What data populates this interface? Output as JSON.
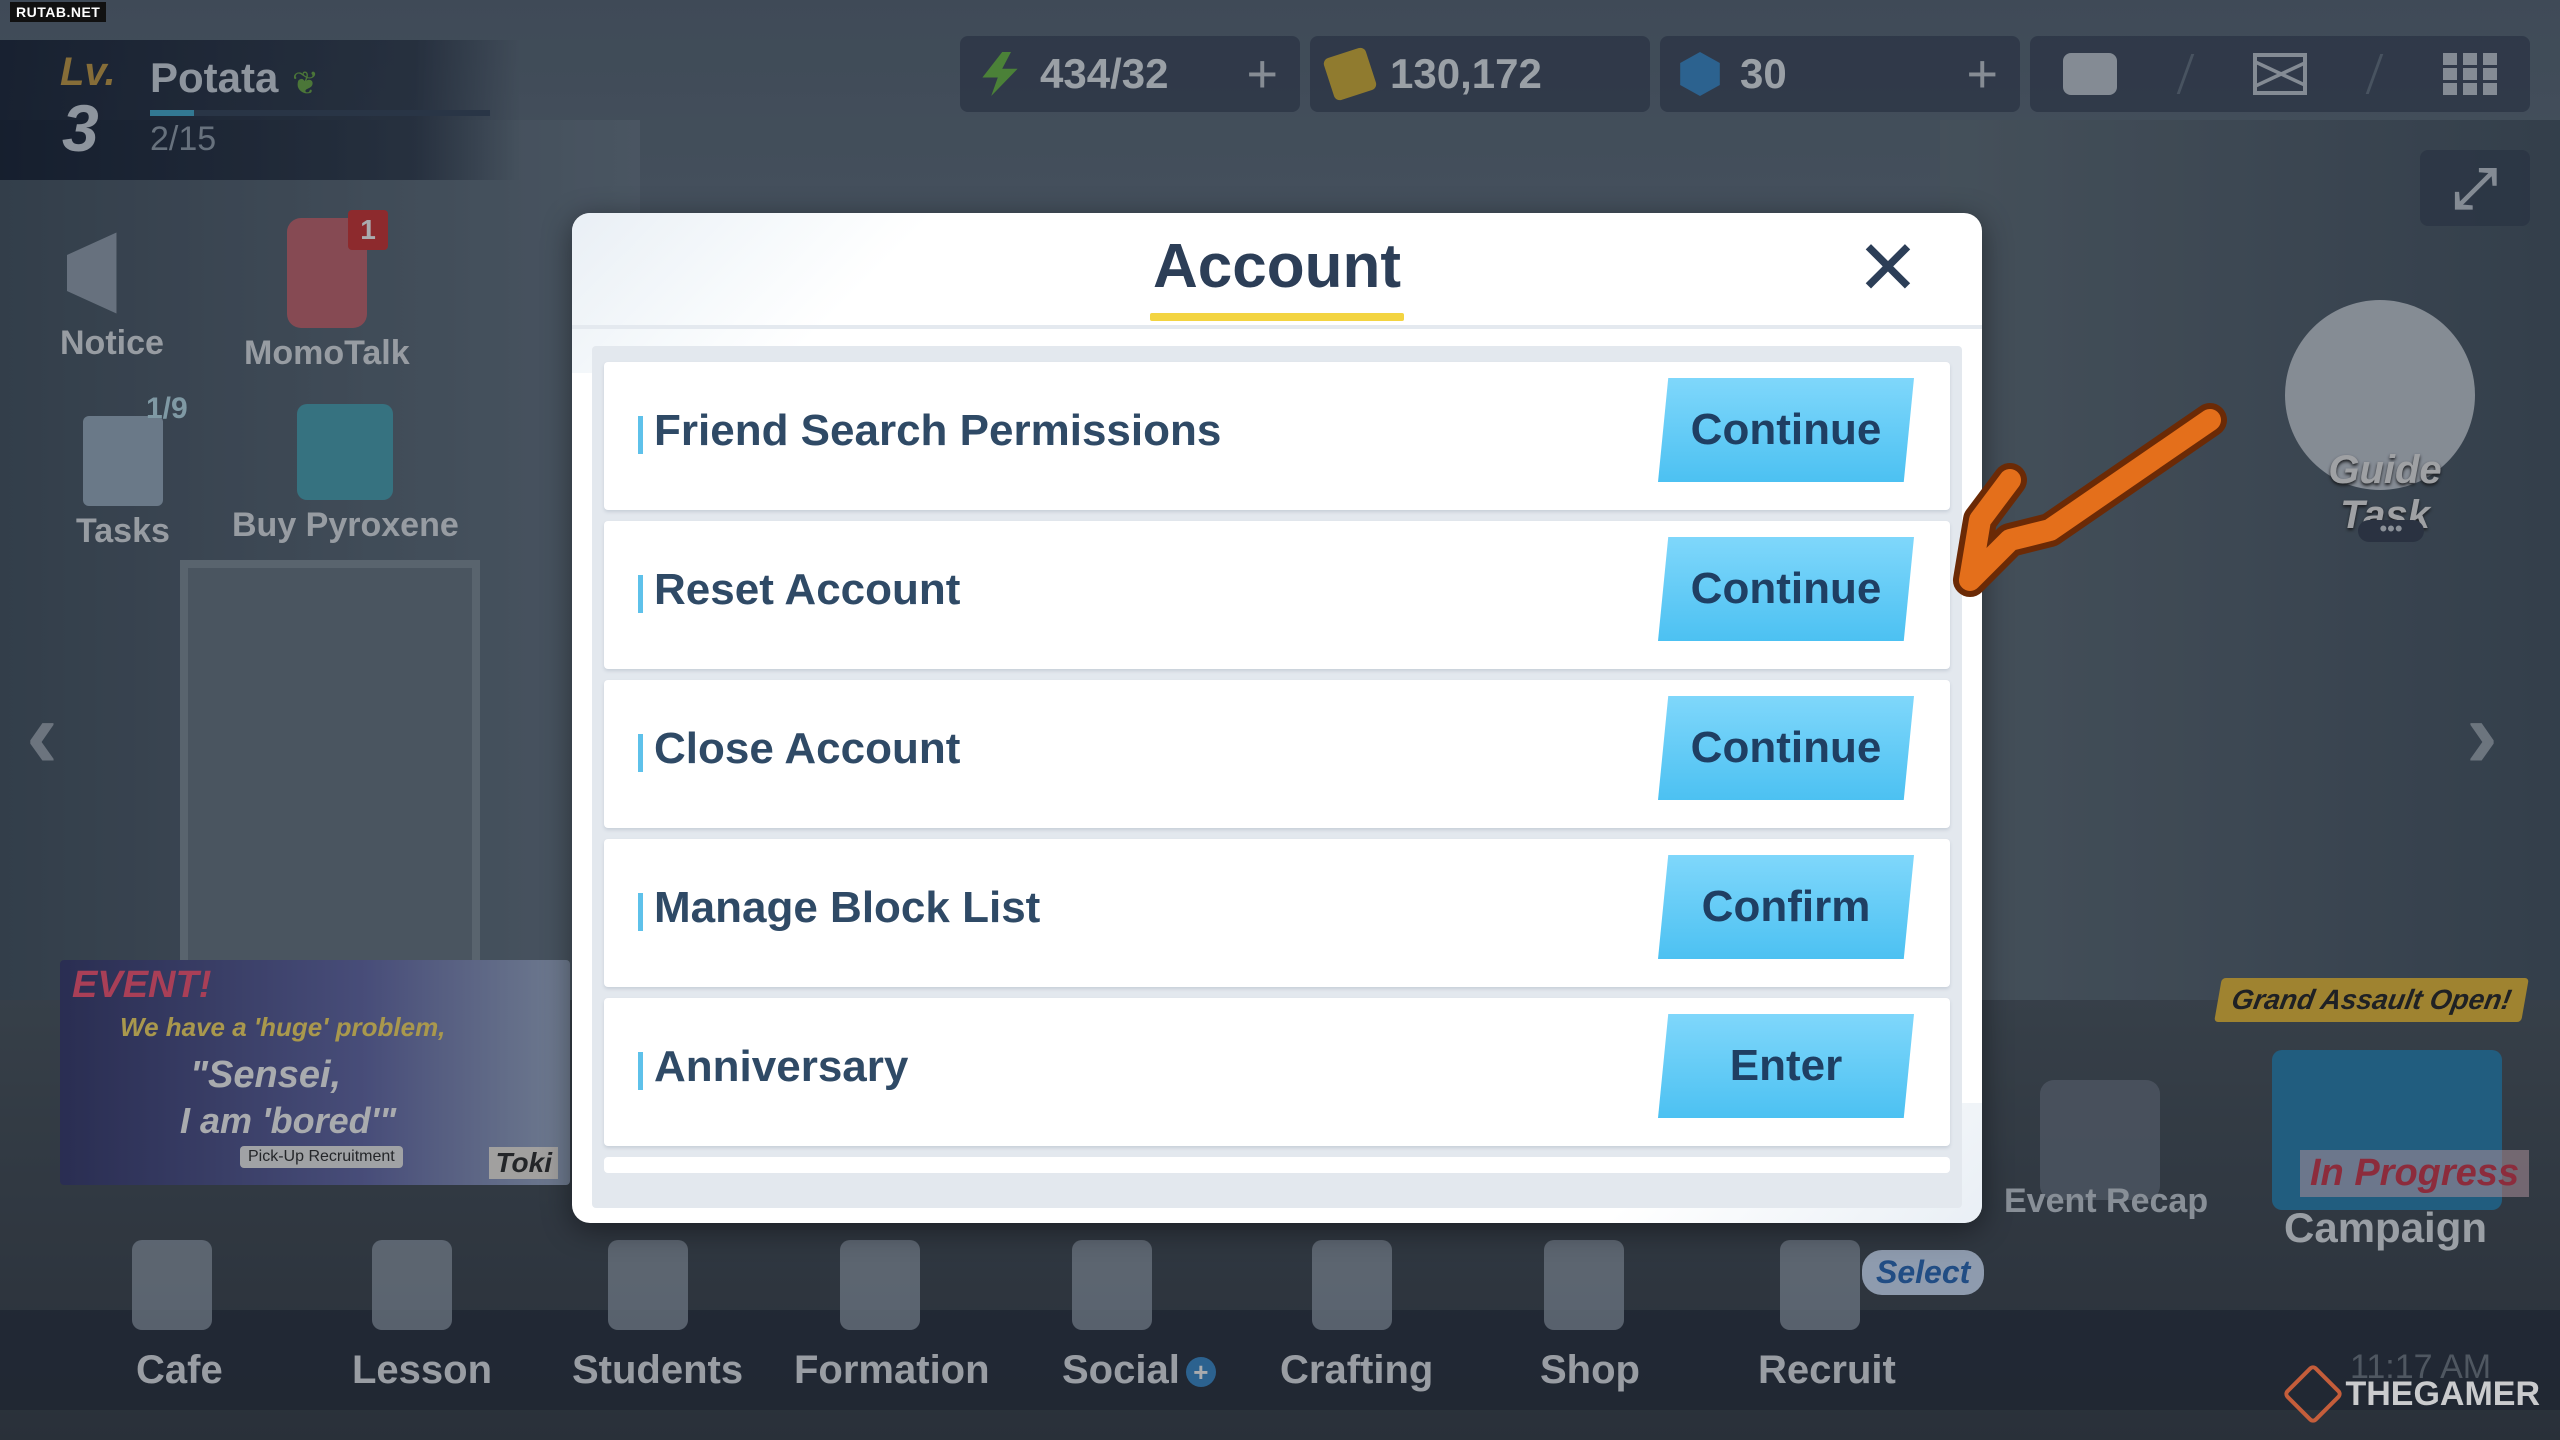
{
  "watermarks": {
    "top_left": "RUTAB.NET",
    "bottom_right": "THEGAMER"
  },
  "player": {
    "level_label": "Lv.",
    "level": "3",
    "name": "Potata",
    "xp": "2/15",
    "xp_fraction": 0.13
  },
  "resources": {
    "ap": "434/32",
    "credits": "130,172",
    "pyroxene": "30",
    "plus": "+"
  },
  "shortcuts": {
    "notice": "Notice",
    "momotalk": "MomoTalk",
    "momotalk_badge": "1",
    "tasks": "Tasks",
    "tasks_count": "1/9",
    "buy_pyroxene": "Buy Pyroxene"
  },
  "event_banner": {
    "tag": "EVENT!",
    "line1": "We have a 'huge' problem,",
    "line2": "\"Sensei,",
    "line3": "I am 'bored'\"",
    "pickup": "Pick-Up Recruitment",
    "character": "Toki"
  },
  "right_widgets": {
    "guide_task": "Guide Task",
    "dots": "•••",
    "grand_assault": "Grand Assault Open!",
    "in_progress": "In Progress",
    "campaign": "Campaign",
    "event_recap": "Event Recap",
    "time": "11:17 AM"
  },
  "bottom_nav": {
    "cafe": "Cafe",
    "lesson": "Lesson",
    "students": "Students",
    "formation": "Formation",
    "social": "Social",
    "crafting": "Crafting",
    "shop": "Shop",
    "recruit": "Recruit",
    "select_badge": "Select",
    "nav_prev": "‹",
    "nav_next": "›"
  },
  "dialog": {
    "title": "Account",
    "close": "✕",
    "rows": [
      {
        "label": "Friend Search Permissions",
        "button": "Continue"
      },
      {
        "label": "Reset Account",
        "button": "Continue"
      },
      {
        "label": "Close Account",
        "button": "Continue"
      },
      {
        "label": "Manage Block List",
        "button": "Confirm"
      },
      {
        "label": "Anniversary",
        "button": "Enter"
      }
    ]
  },
  "colors": {
    "accent_button": "#4cc1f2",
    "title_underline": "#f3d441",
    "annotation_arrow": "#e46f1b"
  }
}
